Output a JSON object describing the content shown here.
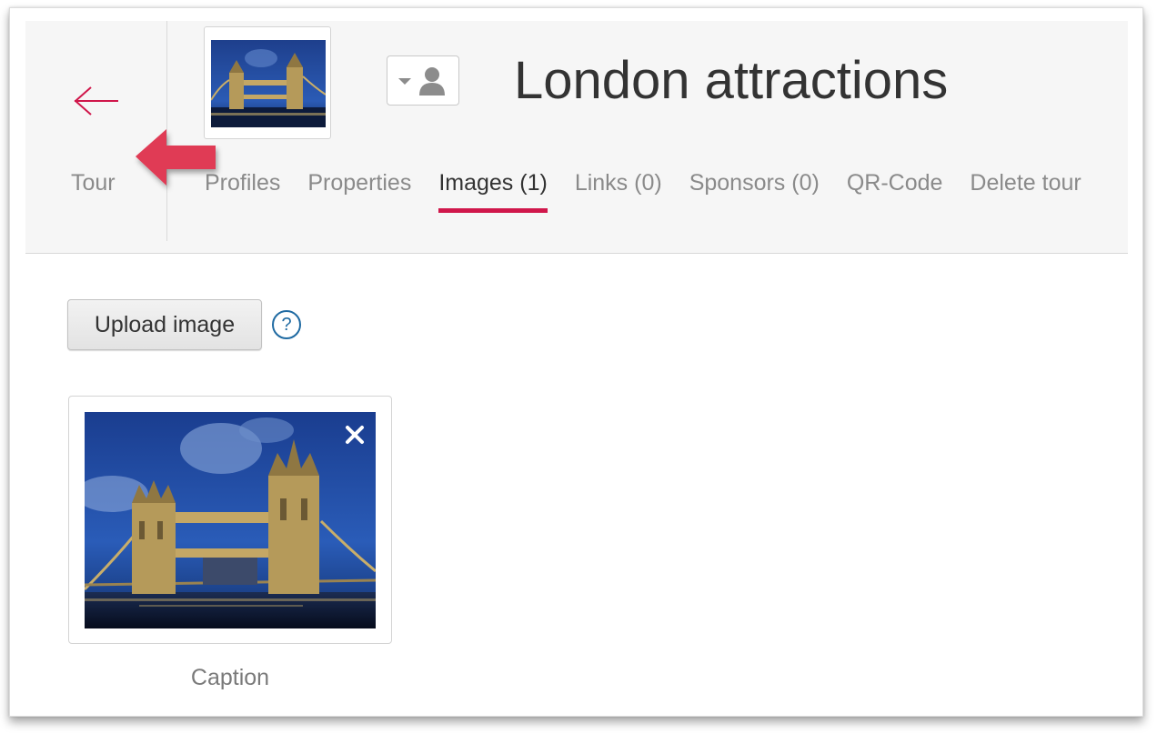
{
  "header": {
    "back_label": "Tour",
    "title": "London attractions",
    "tabs": [
      {
        "label": "Profiles",
        "active": false
      },
      {
        "label": "Properties",
        "active": false
      },
      {
        "label": "Images (1)",
        "active": true
      },
      {
        "label": "Links (0)",
        "active": false
      },
      {
        "label": "Sponsors (0)",
        "active": false
      },
      {
        "label": "QR-Code",
        "active": false
      },
      {
        "label": "Delete tour",
        "active": false
      }
    ]
  },
  "actions": {
    "upload_label": "Upload image",
    "help_glyph": "?"
  },
  "gallery": {
    "items": [
      {
        "caption": "Caption",
        "remove_glyph": "×"
      }
    ]
  },
  "icons": {
    "back": "arrow-left-icon",
    "profile": "user-icon",
    "dropdown": "caret-down-icon",
    "help": "question-circle-icon",
    "remove": "close-icon",
    "annotation": "callout-arrow-icon"
  },
  "colors": {
    "accent": "#d0174b",
    "help_blue": "#1f6aa2",
    "header_bg": "#f6f6f6",
    "annotation_red": "#e03a55"
  }
}
